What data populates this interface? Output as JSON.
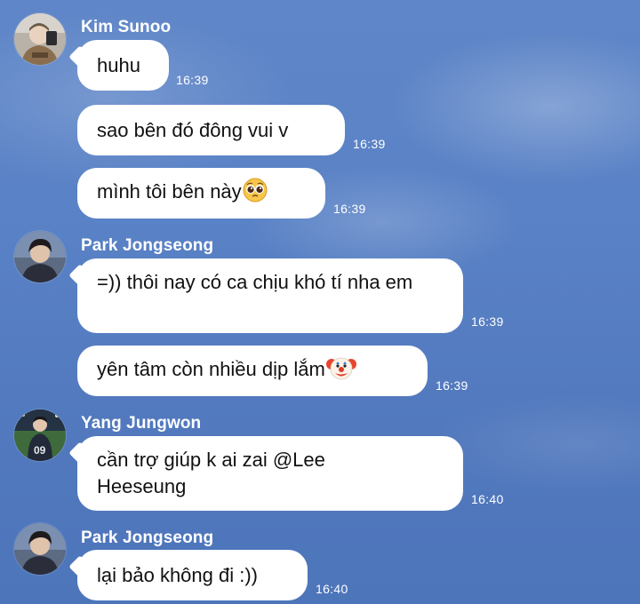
{
  "messages": [
    {
      "sender": "Kim Sunoo",
      "text": "huhu",
      "time": "16:39"
    },
    {
      "text": "sao bên đó đông vui v",
      "time": "16:39"
    },
    {
      "text": "mình tôi bên này",
      "emoji": "pleading-face",
      "time": "16:39"
    },
    {
      "sender": "Park Jongseong",
      "text": "=)) thôi nay có ca chịu khó tí nha em",
      "time": "16:39"
    },
    {
      "text": "yên tâm còn nhiều dịp lắm",
      "emoji": "clown-face",
      "time": "16:39"
    },
    {
      "sender": "Yang Jungwon",
      "text": "cần trợ giúp k ai zai @Lee Heeseung",
      "time": "16:40"
    },
    {
      "sender": "Park Jongseong",
      "text": "lại bảo không đi :))",
      "time": "16:40"
    }
  ],
  "colors": {
    "background": "#5a82c6",
    "bubble": "#ffffff",
    "text": "#111111",
    "meta_text": "#ffffff"
  }
}
